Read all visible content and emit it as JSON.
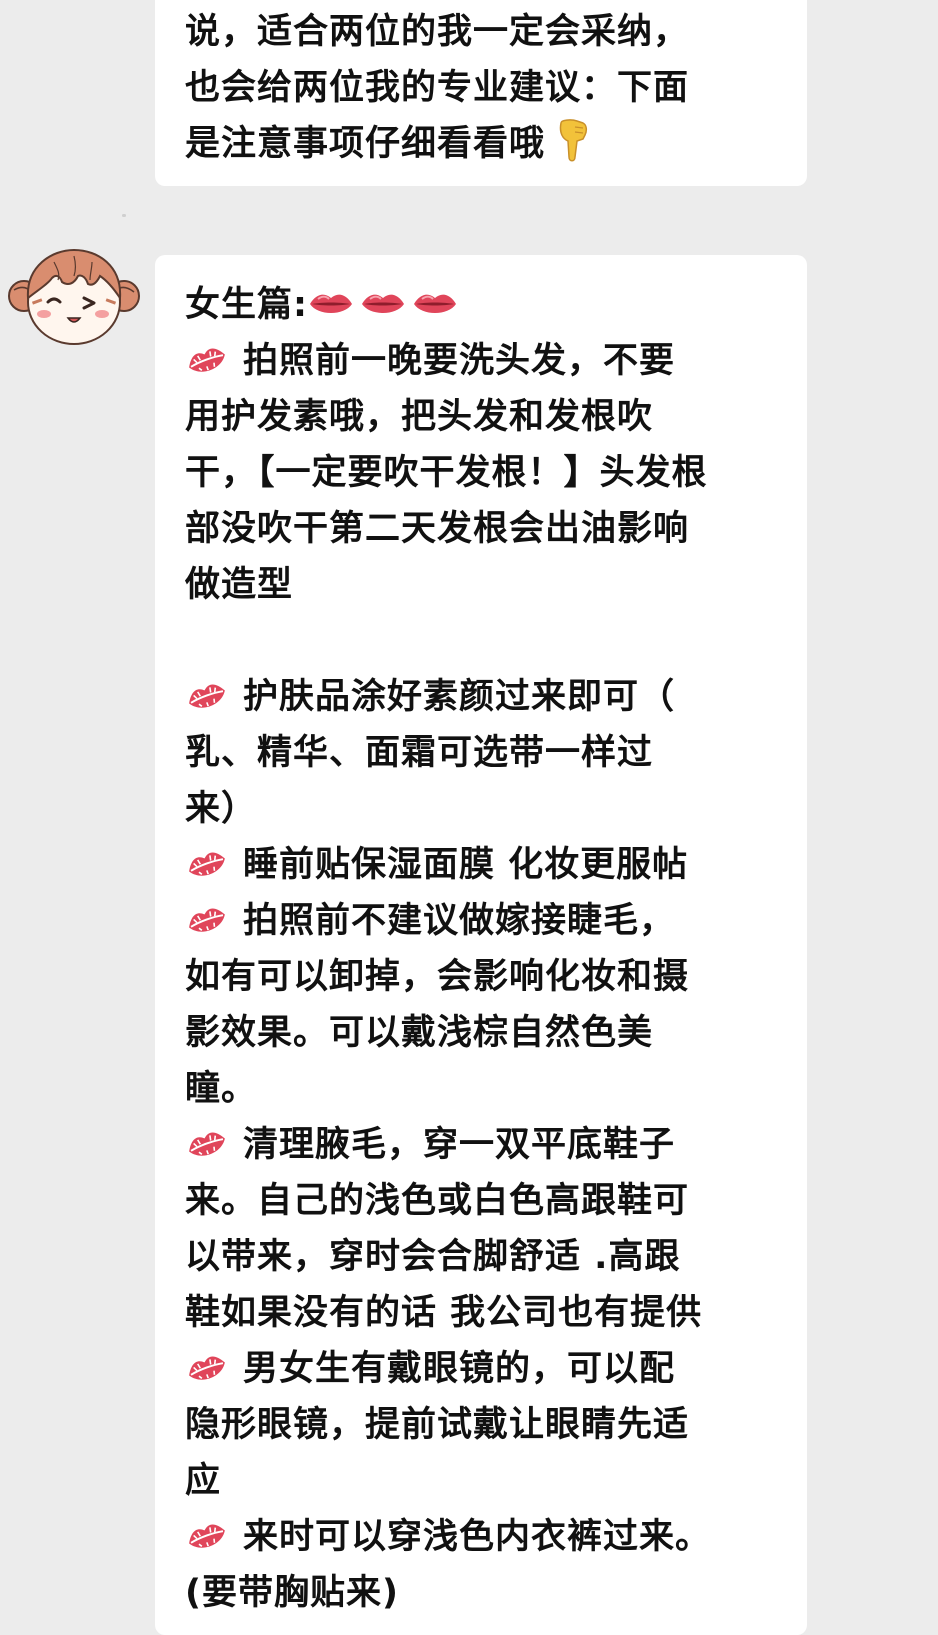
{
  "colors": {
    "background": "#ececec",
    "bubble": "#ffffff",
    "text": "#111111",
    "lips": "#e0455a"
  },
  "top_message": {
    "lines": [
      "说，适合两位的我一定会采纳，",
      "也会给两位我的专业建议：下面",
      "是注意事项仔细看看哦"
    ],
    "end_icon": "backhand-index-pointing-down-icon"
  },
  "main_message": {
    "header": "女生篇:",
    "header_icons": [
      "lips-icon",
      "lips-icon",
      "lips-icon"
    ],
    "bullet_icon": "kiss-mark-icon",
    "items": [
      [
        "拍照前一晚要洗头发，不要",
        "用护发素哦，把头发和发根吹",
        "干，【一定要吹干发根！】头发根",
        "部没吹干第二天发根会出油影响",
        "做造型"
      ],
      [
        "护肤品涂好素颜过来即可（",
        "乳、精华、面霜可选带一样过",
        "来）"
      ],
      [
        "睡前贴保湿面膜 化妆更服帖"
      ],
      [
        "拍照前不建议做嫁接睫毛，",
        "如有可以卸掉，会影响化妆和摄",
        "影效果。可以戴浅棕自然色美",
        "瞳。"
      ],
      [
        "清理腋毛，穿一双平底鞋子",
        "来。自己的浅色或白色高跟鞋可",
        "以带来，穿时会合脚舒适 .高跟",
        "鞋如果没有的话 我公司也有提供"
      ],
      [
        "男女生有戴眼镜的，可以配",
        "隐形眼镜，提前试戴让眼睛先适",
        "应"
      ],
      [
        "来时可以穿浅色内衣裤过来。",
        "(要带胸贴来)"
      ]
    ]
  }
}
